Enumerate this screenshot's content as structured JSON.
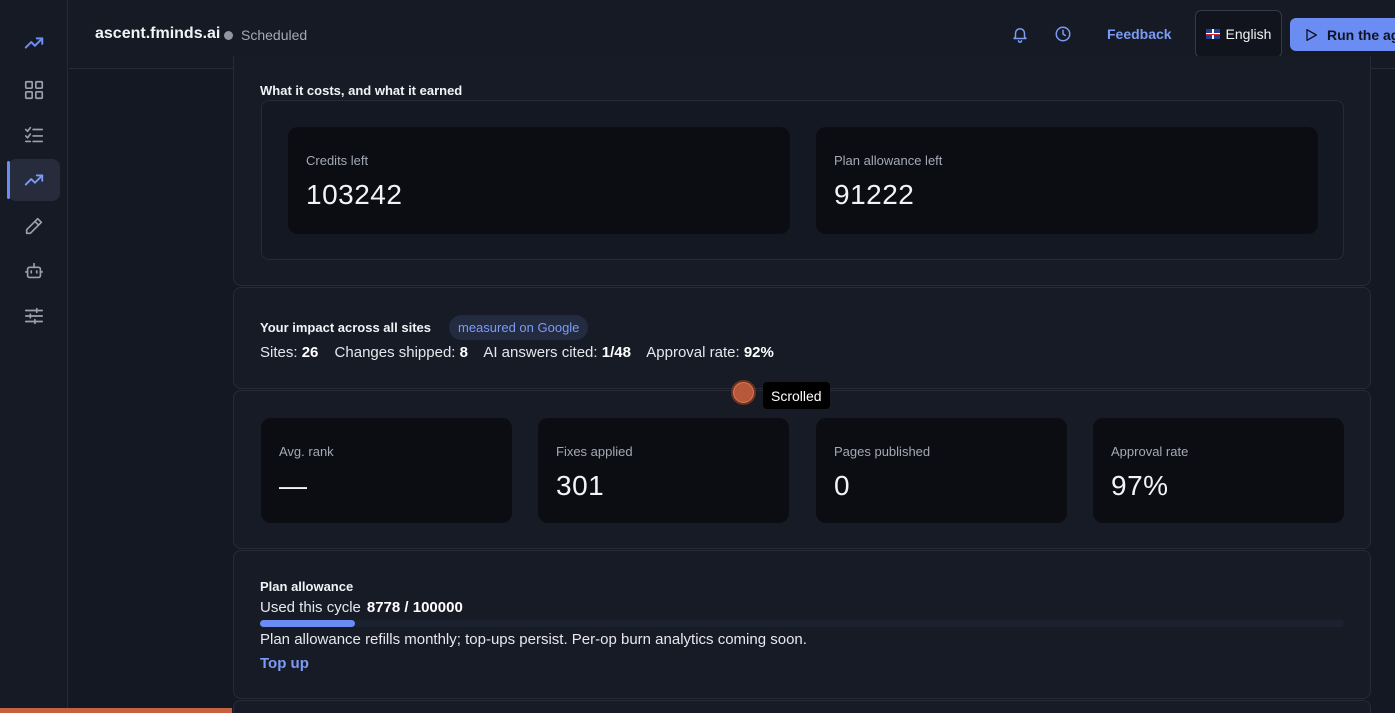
{
  "header": {
    "site_title": "ascent.fminds.ai",
    "status": "Scheduled",
    "feedback_label": "Feedback",
    "language_label": "English",
    "run_label": "Run the agent"
  },
  "sidebar": {
    "items": [
      {
        "name": "logo",
        "icon": "trend-up-icon"
      },
      {
        "name": "dashboard",
        "icon": "grid-icon"
      },
      {
        "name": "tasks",
        "icon": "checklist-icon"
      },
      {
        "name": "analytics",
        "icon": "trend-up-icon",
        "active": true
      },
      {
        "name": "editor",
        "icon": "pencil-icon"
      },
      {
        "name": "agent",
        "icon": "robot-icon"
      },
      {
        "name": "settings",
        "icon": "sliders-icon"
      }
    ]
  },
  "costs": {
    "title": "What it costs, and what it earned",
    "credits_label": "Credits left",
    "credits_value": "103242",
    "allowance_label": "Plan allowance left",
    "allowance_value": "91222"
  },
  "impact": {
    "title": "Your impact across all sites",
    "badge": "measured on Google",
    "sites_label": "Sites:",
    "sites_value": "26",
    "changes_label": "Changes shipped:",
    "changes_value": "8",
    "ai_label": "AI answers cited:",
    "ai_value": "1/48",
    "approval_label": "Approval rate:",
    "approval_value": "92%"
  },
  "metrics": [
    {
      "label": "Avg. rank",
      "value": "—"
    },
    {
      "label": "Fixes applied",
      "value": "301"
    },
    {
      "label": "Pages published",
      "value": "0"
    },
    {
      "label": "Approval rate",
      "value": "97%"
    }
  ],
  "plan": {
    "title": "Plan allowance",
    "used_label": "Used this cycle",
    "used_value": "8778 / 100000",
    "used_fraction": 0.0878,
    "note": "Plan allowance refills monthly; top-ups persist. Per-op burn analytics coming soon.",
    "topup_label": "Top up"
  },
  "tooltip": "Scrolled",
  "colors": {
    "accent": "#6b8cf3",
    "link": "#7c9bf5",
    "background": "#141823",
    "card": "#0b0d12"
  }
}
